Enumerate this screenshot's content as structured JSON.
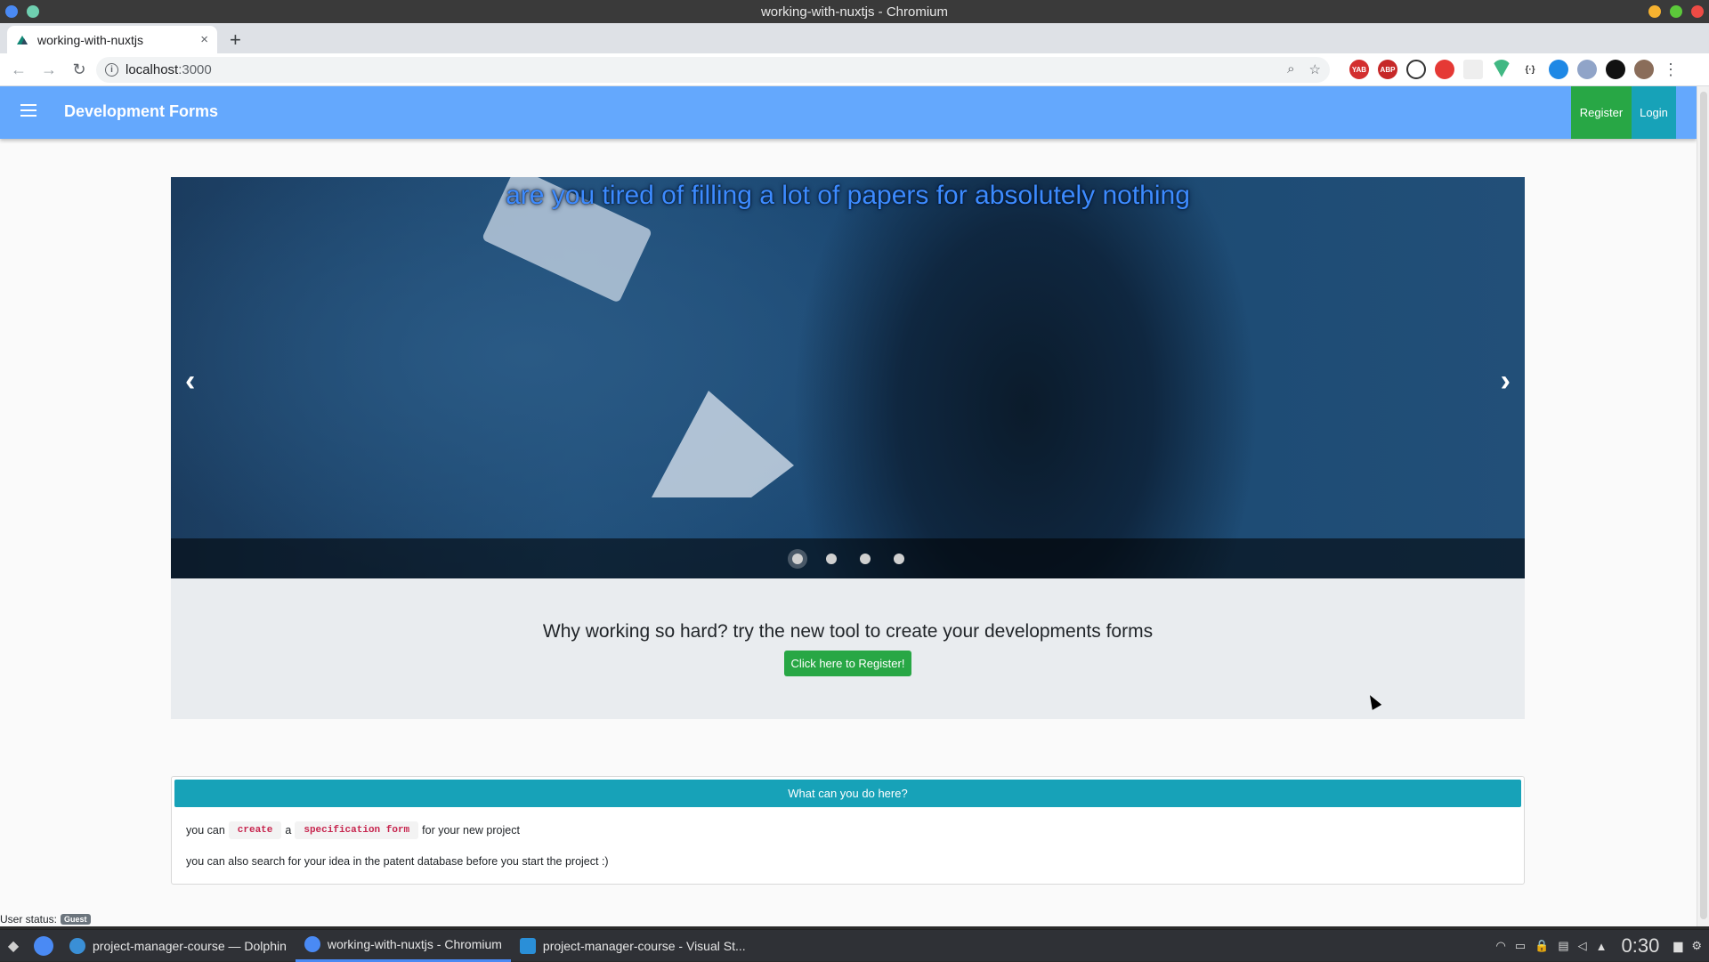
{
  "os": {
    "window_title": "working-with-nuxtjs - Chromium"
  },
  "browser": {
    "tab_title": "working-with-nuxtjs",
    "tab_close": "×",
    "new_tab": "+",
    "url_host": "localhost",
    "url_port": ":3000",
    "extensions": [
      "YAB",
      "ABP",
      "block",
      "ublock",
      "blank",
      "vue",
      "json",
      "react",
      "gear",
      "cursor"
    ]
  },
  "app": {
    "title": "Development Forms",
    "register_label": "Register",
    "login_label": "Login",
    "carousel": {
      "caption": "are you tired of filling a lot of papers for absolutely nothing",
      "prev": "‹",
      "next": "›",
      "slides": 4,
      "active_slide": 0
    },
    "jumbotron": {
      "heading": "Why working so hard? try the new tool to create your developments forms",
      "button_label": "Click here to Register!"
    },
    "card": {
      "header": "What can you do here?",
      "line1_a": "you can",
      "line1_code1": "create",
      "line1_b": "a",
      "line1_code2": "specification form",
      "line1_c": "for your new project",
      "line2": "you can also search for your idea in the patent database before you start the project :)"
    },
    "user_status_label": "User status:",
    "user_status_badge": "Guest"
  },
  "taskbar": {
    "tasks": [
      {
        "label": "project-manager-course — Dolphin"
      },
      {
        "label": "working-with-nuxtjs - Chromium"
      },
      {
        "label": "project-manager-course - Visual St..."
      }
    ],
    "clock": "0:30"
  },
  "colors": {
    "app_bar": "#64a8fd",
    "register_green": "#28a745",
    "login_teal": "#17a2b8"
  }
}
